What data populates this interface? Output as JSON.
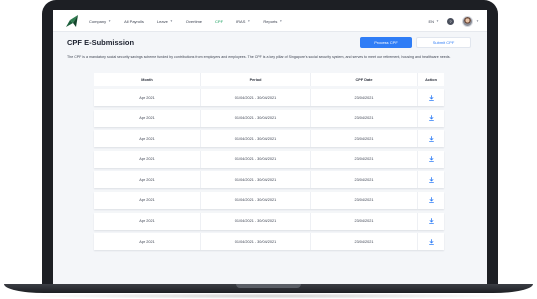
{
  "nav": {
    "items": [
      {
        "label": "Company",
        "caret": true,
        "active": false
      },
      {
        "label": "All Payrolls",
        "caret": false,
        "active": false
      },
      {
        "label": "Leave",
        "caret": true,
        "active": false
      },
      {
        "label": "Overtime",
        "caret": false,
        "active": false
      },
      {
        "label": "CPF",
        "caret": false,
        "active": true
      },
      {
        "label": "IRAS",
        "caret": true,
        "active": false
      },
      {
        "label": "Reports",
        "caret": true,
        "active": false
      }
    ],
    "language": "EN",
    "help_glyph": "?"
  },
  "page": {
    "title": "CPF E-Submission",
    "process_button": "Process CPF",
    "submit_button": "Submit CPF",
    "description": "The CPF is a mandatory social security savings scheme funded by contributions from employers and employees. The CPF is a key pillar of Singapore's social security system, and serves to meet our retirement, housing and healthcare needs."
  },
  "table": {
    "headers": {
      "month": "Month",
      "period": "Period",
      "cpf_date": "CPF Date",
      "action": "Action"
    },
    "rows": [
      {
        "month": "Apr 2021",
        "period": "01/04/2021 - 30/04/2021",
        "cpf_date": "23/04/2021"
      },
      {
        "month": "Apr 2021",
        "period": "01/04/2021 - 30/04/2021",
        "cpf_date": "23/04/2021"
      },
      {
        "month": "Apr 2021",
        "period": "01/04/2021 - 30/04/2021",
        "cpf_date": "23/04/2021"
      },
      {
        "month": "Apr 2021",
        "period": "01/04/2021 - 30/04/2021",
        "cpf_date": "23/04/2021"
      },
      {
        "month": "Apr 2021",
        "period": "01/04/2021 - 30/04/2021",
        "cpf_date": "23/04/2021"
      },
      {
        "month": "Apr 2021",
        "period": "01/04/2021 - 30/04/2021",
        "cpf_date": "23/04/2021"
      },
      {
        "month": "Apr 2021",
        "period": "01/04/2021 - 30/04/2021",
        "cpf_date": "23/04/2021"
      },
      {
        "month": "Apr 2021",
        "period": "01/04/2021 - 30/04/2021",
        "cpf_date": "23/04/2021"
      }
    ],
    "action_icon": "download-icon"
  },
  "colors": {
    "accent": "#2f7df6",
    "nav_active": "#0f9d58",
    "background": "#f4f6f9",
    "frame": "#1d1f24"
  }
}
